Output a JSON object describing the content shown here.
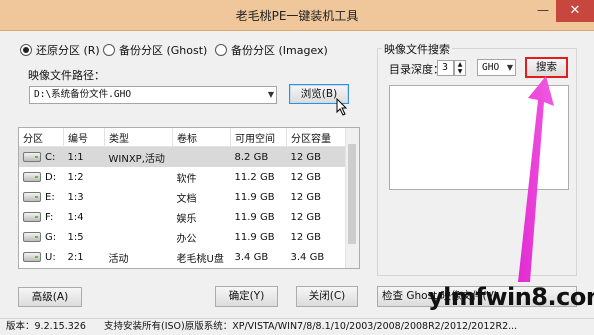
{
  "window": {
    "title": "老毛桃PE一键装机工具",
    "minimize": "—",
    "close": "✕"
  },
  "mode_options": [
    {
      "label": "还原分区 (R)",
      "selected": true
    },
    {
      "label": "备份分区 (Ghost)",
      "selected": false
    },
    {
      "label": "备份分区 (Imagex)",
      "selected": false
    }
  ],
  "image_path": {
    "label": "映像文件路径：",
    "value": "D:\\系统备份文件.GHO",
    "browse_label": "浏览(B)"
  },
  "table": {
    "headers": [
      "分区",
      "编号",
      "类型",
      "卷标",
      "可用空间",
      "分区容量"
    ],
    "rows": [
      {
        "drive": "C:",
        "num": "1:1",
        "type": "WINXP,活动",
        "label": "",
        "free": "8.2 GB",
        "size": "12 GB",
        "selected": true
      },
      {
        "drive": "D:",
        "num": "1:2",
        "type": "",
        "label": "软件",
        "free": "11.2 GB",
        "size": "12 GB",
        "selected": false
      },
      {
        "drive": "E:",
        "num": "1:3",
        "type": "",
        "label": "文档",
        "free": "11.9 GB",
        "size": "12 GB",
        "selected": false
      },
      {
        "drive": "F:",
        "num": "1:4",
        "type": "",
        "label": "娱乐",
        "free": "11.9 GB",
        "size": "12 GB",
        "selected": false
      },
      {
        "drive": "G:",
        "num": "1:5",
        "type": "",
        "label": "办公",
        "free": "11.9 GB",
        "size": "12 GB",
        "selected": false
      },
      {
        "drive": "U:",
        "num": "2:1",
        "type": "活动",
        "label": "老毛桃U盘",
        "free": "3.4 GB",
        "size": "3.4 GB",
        "selected": false
      }
    ]
  },
  "search_panel": {
    "group_label": "映像文件搜索",
    "depth_label": "目录深度：",
    "depth_value": "3",
    "ext_value": "GHO",
    "search_label": "搜索"
  },
  "buttons": {
    "advanced": "高级(A)",
    "ok": "确定(Y)",
    "close": "关闭(C)",
    "check": "检查 Ghost 映像文件(V)"
  },
  "watermark": "ylmfwin8.com",
  "status": {
    "version": "版本：9.2.15.326",
    "support": "支持安装所有(ISO)原版系统：XP/VISTA/WIN7/8/8.1/10/2003/2008/2008R2/2012/2012R2..."
  },
  "colors": {
    "titlebar": "#efc79a",
    "close": "#c7463d",
    "arrow": "#e22bd2",
    "highlight": "#e21d1d",
    "focus": "#3b8bd6"
  }
}
